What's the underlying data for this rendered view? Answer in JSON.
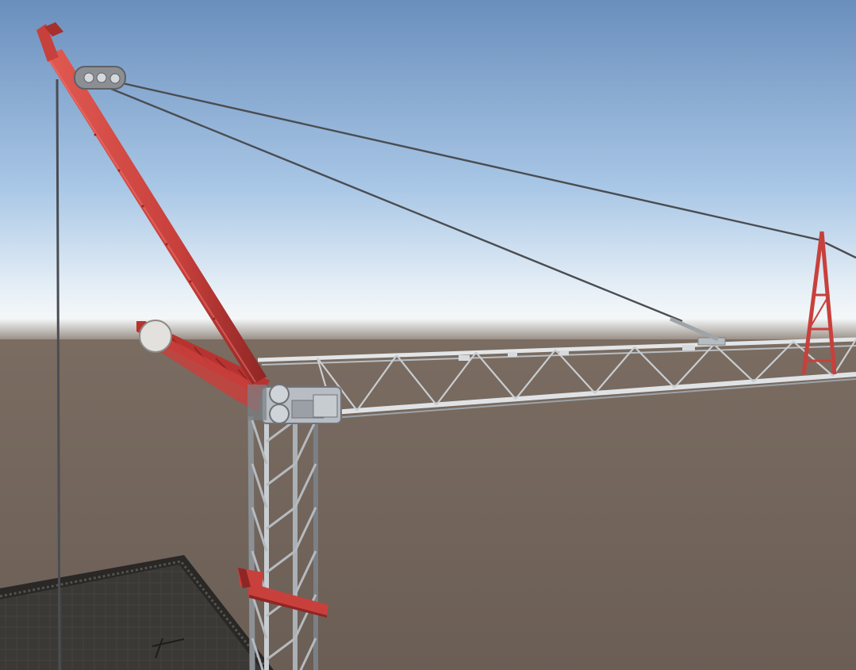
{
  "scene": {
    "description_visible_text": "",
    "colors": {
      "sky_top": "#6a8fbd",
      "sky_mid": "#a9c7e6",
      "sky_horizon": "#f4f7f8",
      "ground": "#6e6158",
      "ground_far": "#7a6c61",
      "crane_red": "#c8403c",
      "crane_red_dark": "#8e2624",
      "steel_light": "#d9dde0",
      "steel_mid": "#a9aeb3",
      "steel_dark": "#5e6166",
      "cable": "#4a4d52",
      "slab": "#3b3936",
      "slab_edge": "#2a2826"
    }
  }
}
